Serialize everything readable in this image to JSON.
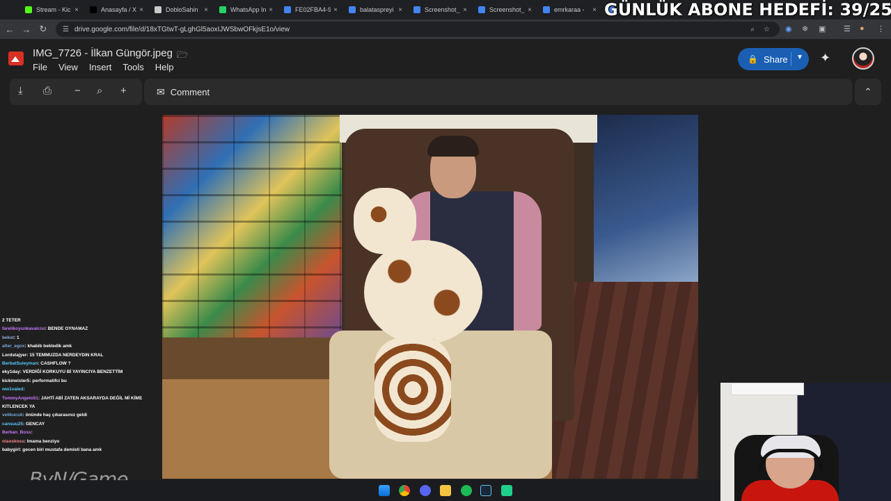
{
  "browser": {
    "tabs": [
      {
        "title": "Stream - Kic",
        "color": "#53fc18"
      },
      {
        "title": "Anasayfa / X",
        "color": "#000000"
      },
      {
        "title": "DobloSahin",
        "color": "#c9c9c9"
      },
      {
        "title": "WhatsApp In",
        "color": "#25d366"
      },
      {
        "title": "FE02FBA4-9",
        "color": "#4285f4"
      },
      {
        "title": "balataspreyi",
        "color": "#4285f4"
      },
      {
        "title": "Screenshot_",
        "color": "#4285f4"
      },
      {
        "title": "Screenshot_",
        "color": "#4285f4"
      },
      {
        "title": "emrkaraa -",
        "color": "#4285f4"
      },
      {
        "title": "",
        "color": "#4285f4"
      }
    ],
    "url": "drive.google.com/file/d/18xTGtwT-gLghGl5aoxIJWSbwOFkjsE1o/view"
  },
  "header": {
    "filename": "IMG_7726 - İlkan Güngör.jpeg",
    "menu": [
      "File",
      "View",
      "Insert",
      "Tools",
      "Help"
    ],
    "share_label": "Share"
  },
  "viewer_toolbar": {
    "comment_label": "Comment"
  },
  "overlay": {
    "goal_text": "GÜNLÜK ABONE HEDEFİ: 39/25",
    "watermark": "ByN/Game"
  },
  "chat": [
    {
      "user": "",
      "msg": "2 TETER",
      "color": "#9ad"
    },
    {
      "user": "farelikoyunkavalcisi",
      "msg": ": BENDE OYNAMAZ",
      "color": "#c879ff"
    },
    {
      "user": "bekst",
      "msg": ": 1",
      "color": "#9ad"
    },
    {
      "user": "alter_egox",
      "msg": ": khabib bekledik amk",
      "color": "#7ad"
    },
    {
      "user": "Lordstajyer",
      "msg": ": 15 TEMMUZDA NERDEYDIN KRAL",
      "color": "#ffffff"
    },
    {
      "user": "BerbatSuleyman",
      "msg": ": CASHFLOW ?",
      "color": "#5cf"
    },
    {
      "user": "eky1day",
      "msg": ": VERDİĞİ KORKUYU Bİ YAYINCIYA BENZETTİM",
      "color": "#ffffff"
    },
    {
      "user": "kickmeister5",
      "msg": ": performatifci bu",
      "color": "#ffffff"
    },
    {
      "user": "ww1valed",
      "msg": ":",
      "color": "#5cf"
    },
    {
      "user": "TommyAngelo51",
      "msg": ": JAHTİ ABİ ZATEN AKSARAYDA DEĞİL Mİ KİME",
      "color": "#c879ff"
    },
    {
      "user": "",
      "msg": "KITLENCEK YA",
      "color": "#ffffff"
    },
    {
      "user": "velikucuk",
      "msg": ": önünde haç çıkarasınız geldi",
      "color": "#7ad"
    },
    {
      "user": "cansuu25",
      "msg": ": GENCAY",
      "color": "#5cf"
    },
    {
      "user": "Berkan_Boss",
      "msg": ":",
      "color": "#c879ff"
    },
    {
      "user": "nisoskoss",
      "msg": ": Imama benziyo",
      "color": "#f88"
    },
    {
      "user": "babygirl",
      "msg": ": gecen biri mustafa demisti bana amk",
      "color": "#ffffff"
    }
  ],
  "icons": {
    "back": "arrow-left-icon",
    "forward": "arrow-right-icon",
    "reload": "reload-icon",
    "download": "download-icon",
    "print": "print-icon",
    "zoom_out": "minus-icon",
    "zoom": "magnifier-icon",
    "zoom_in": "plus-icon",
    "comment": "comment-icon",
    "collapse": "chevron-up-icon",
    "gemini": "sparkle-icon"
  },
  "colors": {
    "share_button": "#1a5fb4",
    "file_icon": "#d93025"
  }
}
